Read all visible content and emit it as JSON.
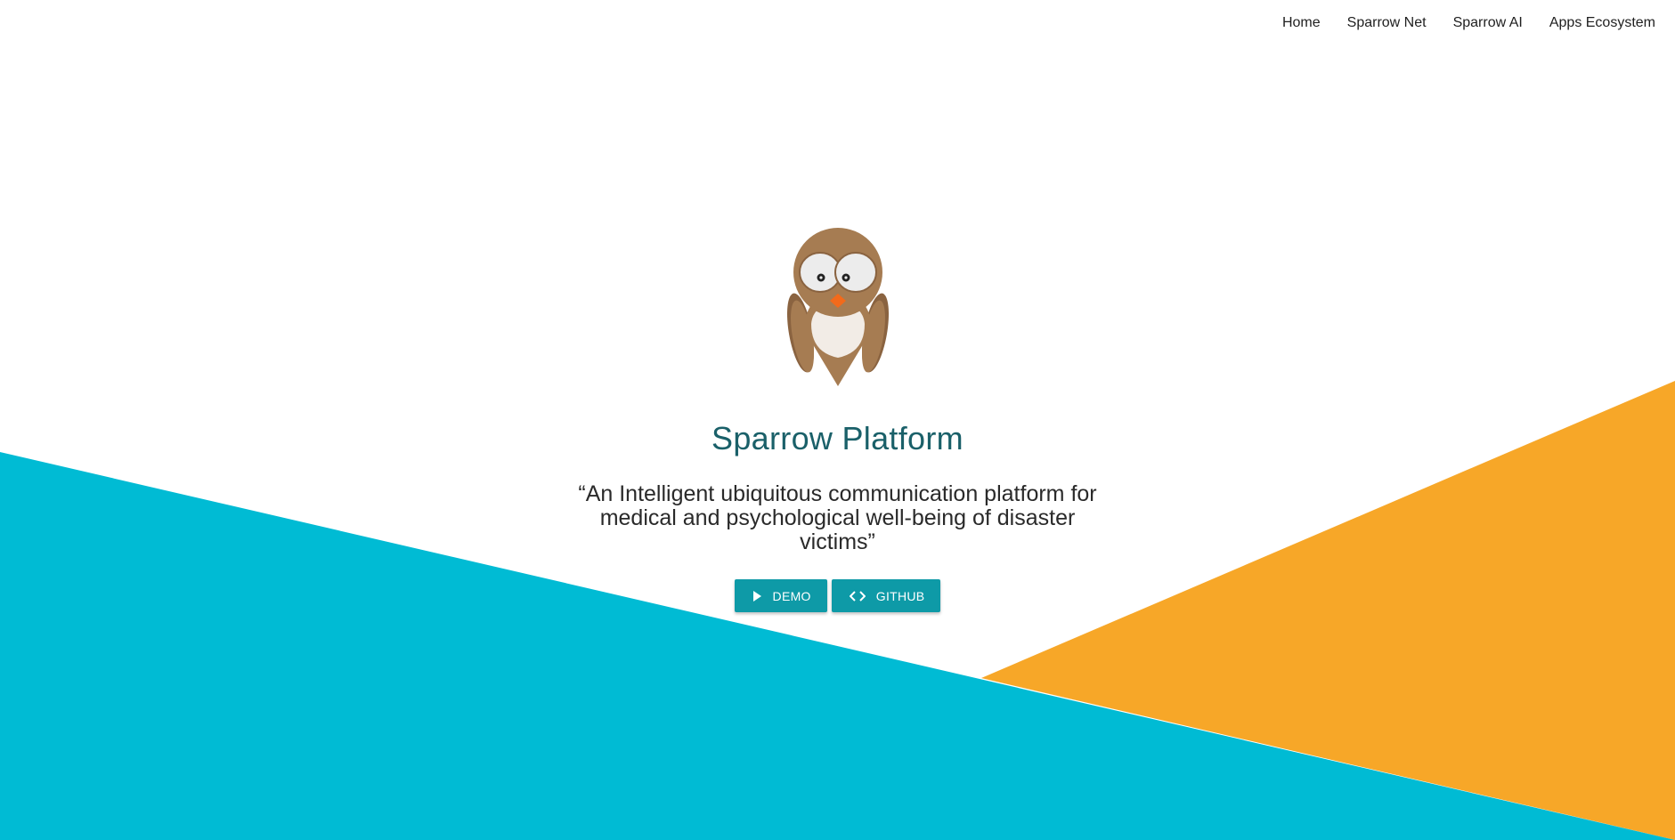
{
  "nav": {
    "items": [
      {
        "label": "Home"
      },
      {
        "label": "Sparrow Net"
      },
      {
        "label": "Sparrow AI"
      },
      {
        "label": "Apps Ecosystem"
      }
    ]
  },
  "hero": {
    "logo_icon": "owl-logo-icon",
    "title": "Sparrow Platform",
    "tagline": "“An Intelligent ubiquitous communication platform for medical and psychological well-being of disaster victims”"
  },
  "actions": {
    "demo_label": "DEMO",
    "demo_icon": "play-icon",
    "github_label": "GITHUB",
    "github_icon": "code-icon"
  },
  "colors": {
    "accent_blue": "#00BBD4",
    "accent_orange": "#F7A728",
    "button": "#0E9AA7",
    "title": "#1A6069"
  }
}
